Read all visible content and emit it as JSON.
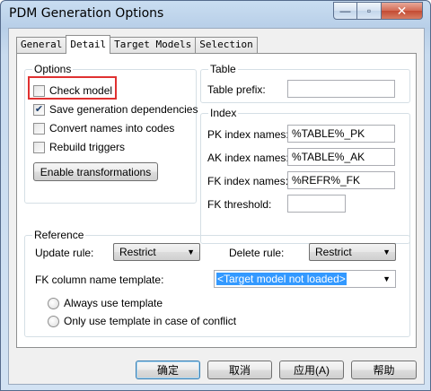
{
  "window": {
    "title": "PDM Generation Options",
    "controls": {
      "minimize": "—",
      "maximize": "▫",
      "close": "✕"
    }
  },
  "tabs": [
    "General",
    "Detail",
    "Target Models",
    "Selection"
  ],
  "active_tab": "Detail",
  "options": {
    "legend": "Options",
    "check_model": {
      "label": "Check model",
      "checked": false
    },
    "save_dependencies": {
      "label": "Save generation dependencies",
      "checked": true
    },
    "convert_names": {
      "label": "Convert names into codes",
      "checked": false
    },
    "rebuild_triggers": {
      "label": "Rebuild triggers",
      "checked": false
    },
    "enable_transformations": "Enable transformations"
  },
  "table": {
    "legend": "Table",
    "prefix_label": "Table prefix:",
    "prefix_value": ""
  },
  "index": {
    "legend": "Index",
    "pk_label": "PK index names:",
    "pk_value": "%TABLE%_PK",
    "ak_label": "AK index names:",
    "ak_value": "%TABLE%_AK",
    "fk_label": "FK index names:",
    "fk_value": "%REFR%_FK",
    "threshold_label": "FK threshold:",
    "threshold_value": ""
  },
  "reference": {
    "legend": "Reference",
    "update_rule_label": "Update rule:",
    "update_rule_value": "Restrict",
    "delete_rule_label": "Delete rule:",
    "delete_rule_value": "Restrict",
    "fk_template_label": "FK column name template:",
    "fk_template_value": "<Target model not loaded>",
    "always_use": "Always use template",
    "only_conflict": "Only use template in case of conflict"
  },
  "buttons": {
    "ok": "确定",
    "cancel": "取消",
    "apply": "应用(A)",
    "help": "帮助"
  },
  "icons": {
    "check": "✔",
    "dropdown": "▼"
  },
  "colors": {
    "highlight": "#e03131",
    "selection": "#3399ff"
  }
}
